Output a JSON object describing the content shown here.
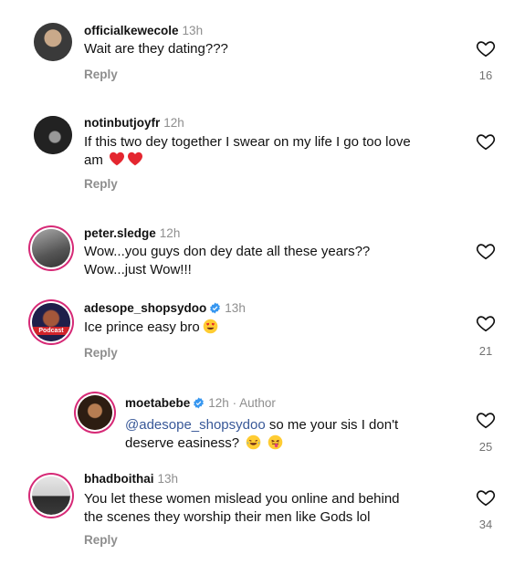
{
  "comments": [
    {
      "username": "officialkewecole",
      "time": "13h",
      "text": "Wait are they dating???",
      "reply_label": "Reply",
      "likes": "16"
    },
    {
      "username": "notinbutjoyfr",
      "time": "12h",
      "text_line1": "If this two dey together I swear on my life I go too love",
      "text_line2": "am",
      "reply_label": "Reply",
      "likes": ""
    },
    {
      "username": "peter.sledge",
      "time": "12h",
      "text_line1": "Wow...you guys don dey date all these years??",
      "text_line2": "Wow...just Wow!!!",
      "reply_label": "",
      "likes": ""
    },
    {
      "username": "adesope_shopsydoo",
      "time": "13h",
      "text": "Ice prince easy bro",
      "reply_label": "Reply",
      "likes": "21",
      "avatar_text": "Podcast"
    },
    {
      "username": "moetabebe",
      "time": "12h",
      "author_label": "Author",
      "mention": "@adesope_shopsydoo",
      "text_line1_rest": " so me your sis I don't",
      "text_line2": "deserve easiness?",
      "reply_label": "",
      "likes": "25"
    },
    {
      "username": "bhadboithai",
      "time": "13h",
      "text_line1": "You let these women mislead you online and behind",
      "text_line2": "the scenes they worship their men like Gods lol",
      "reply_label": "Reply",
      "likes": "34"
    }
  ],
  "colors": {
    "ring": "#d62976",
    "verified": "#3797f0",
    "mention": "#385898",
    "muted": "#8e8e8e"
  }
}
